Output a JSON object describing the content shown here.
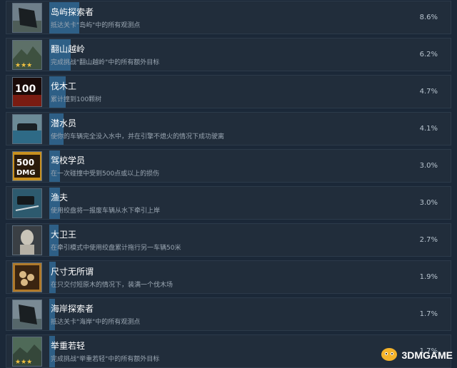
{
  "achievements": [
    {
      "title": "岛屿探索者",
      "desc": "抵达关卡\"岛屿\"中的所有观测点",
      "pct": "8.6%",
      "fill": 0.086,
      "icon": "flag-icon"
    },
    {
      "title": "翻山越岭",
      "desc": "完成挑战\"翻山越岭\"中的所有额外目标",
      "pct": "6.2%",
      "fill": 0.062,
      "icon": "mountain-stars-icon"
    },
    {
      "title": "伐木工",
      "desc": "累计撞到100颗树",
      "pct": "4.7%",
      "fill": 0.047,
      "icon": "hundred-trees-icon"
    },
    {
      "title": "潜水员",
      "desc": "使你的车辆完全没入水中，并在引擎不熄火的情况下成功驶离",
      "pct": "4.1%",
      "fill": 0.041,
      "icon": "submerged-truck-icon"
    },
    {
      "title": "驾校学员",
      "desc": "在一次碰撞中受到500点或以上的损伤",
      "pct": "3.0%",
      "fill": 0.03,
      "icon": "500-dmg-icon"
    },
    {
      "title": "渔夫",
      "desc": "使用绞盘将一报废车辆从水下牵引上岸",
      "pct": "3.0%",
      "fill": 0.03,
      "icon": "winch-truck-icon"
    },
    {
      "title": "大卫王",
      "desc": "在牵引模式中使用绞盘累计拖行另一车辆50米",
      "pct": "2.7%",
      "fill": 0.027,
      "icon": "statue-icon"
    },
    {
      "title": "尺寸无所谓",
      "desc": "在只交付短原木的情况下，装满一个伐木场",
      "pct": "1.9%",
      "fill": 0.019,
      "icon": "logs-icon"
    },
    {
      "title": "海岸探索者",
      "desc": "抵达关卡\"海岸\"中的所有观测点",
      "pct": "1.7%",
      "fill": 0.017,
      "icon": "flag-icon"
    },
    {
      "title": "举重若轻",
      "desc": "完成挑战\"举重若轻\"中的所有额外目标",
      "pct": "1.7%",
      "fill": 0.017,
      "icon": "mountain-stars-icon"
    }
  ],
  "watermark": {
    "text": "3DMGAME",
    "icon": "mascot-icon"
  },
  "colors": {
    "background": "#1b2838",
    "row": "#212d3b",
    "bar": "#2e5f86",
    "percent": "#b8c4cf"
  }
}
